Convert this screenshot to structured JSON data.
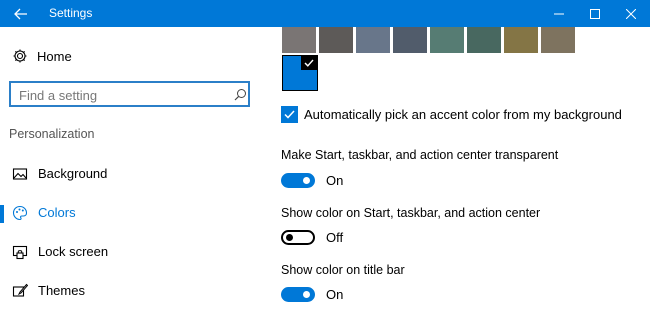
{
  "window": {
    "title": "Settings",
    "accent_color": "#0078d7",
    "controls": [
      "minimize-icon",
      "maximize-icon",
      "close-icon"
    ]
  },
  "sidebar": {
    "home_label": "Home",
    "search_placeholder": "Find a setting",
    "section_title": "Personalization",
    "items": [
      {
        "label": "Background",
        "icon": "picture-icon",
        "active": false
      },
      {
        "label": "Colors",
        "icon": "palette-icon",
        "active": true
      },
      {
        "label": "Lock screen",
        "icon": "lock-screen-icon",
        "active": false
      },
      {
        "label": "Themes",
        "icon": "paintbrush-icon",
        "active": false
      }
    ]
  },
  "colors": {
    "swatches": [
      "#7a7574",
      "#5d5a58",
      "#68768a",
      "#515c6b",
      "#567c73",
      "#486860",
      "#847545",
      "#7e735f"
    ],
    "selected_color": "#0078d7"
  },
  "settings": {
    "auto_pick_label": "Automatically pick an accent color from my background",
    "auto_pick_checked": true,
    "transparent_label": "Make Start, taskbar, and action center transparent",
    "transparent_state": "On",
    "show_color_start_label": "Show color on Start, taskbar, and action center",
    "show_color_start_state": "Off",
    "show_color_title_label": "Show color on title bar",
    "show_color_title_state": "On"
  }
}
